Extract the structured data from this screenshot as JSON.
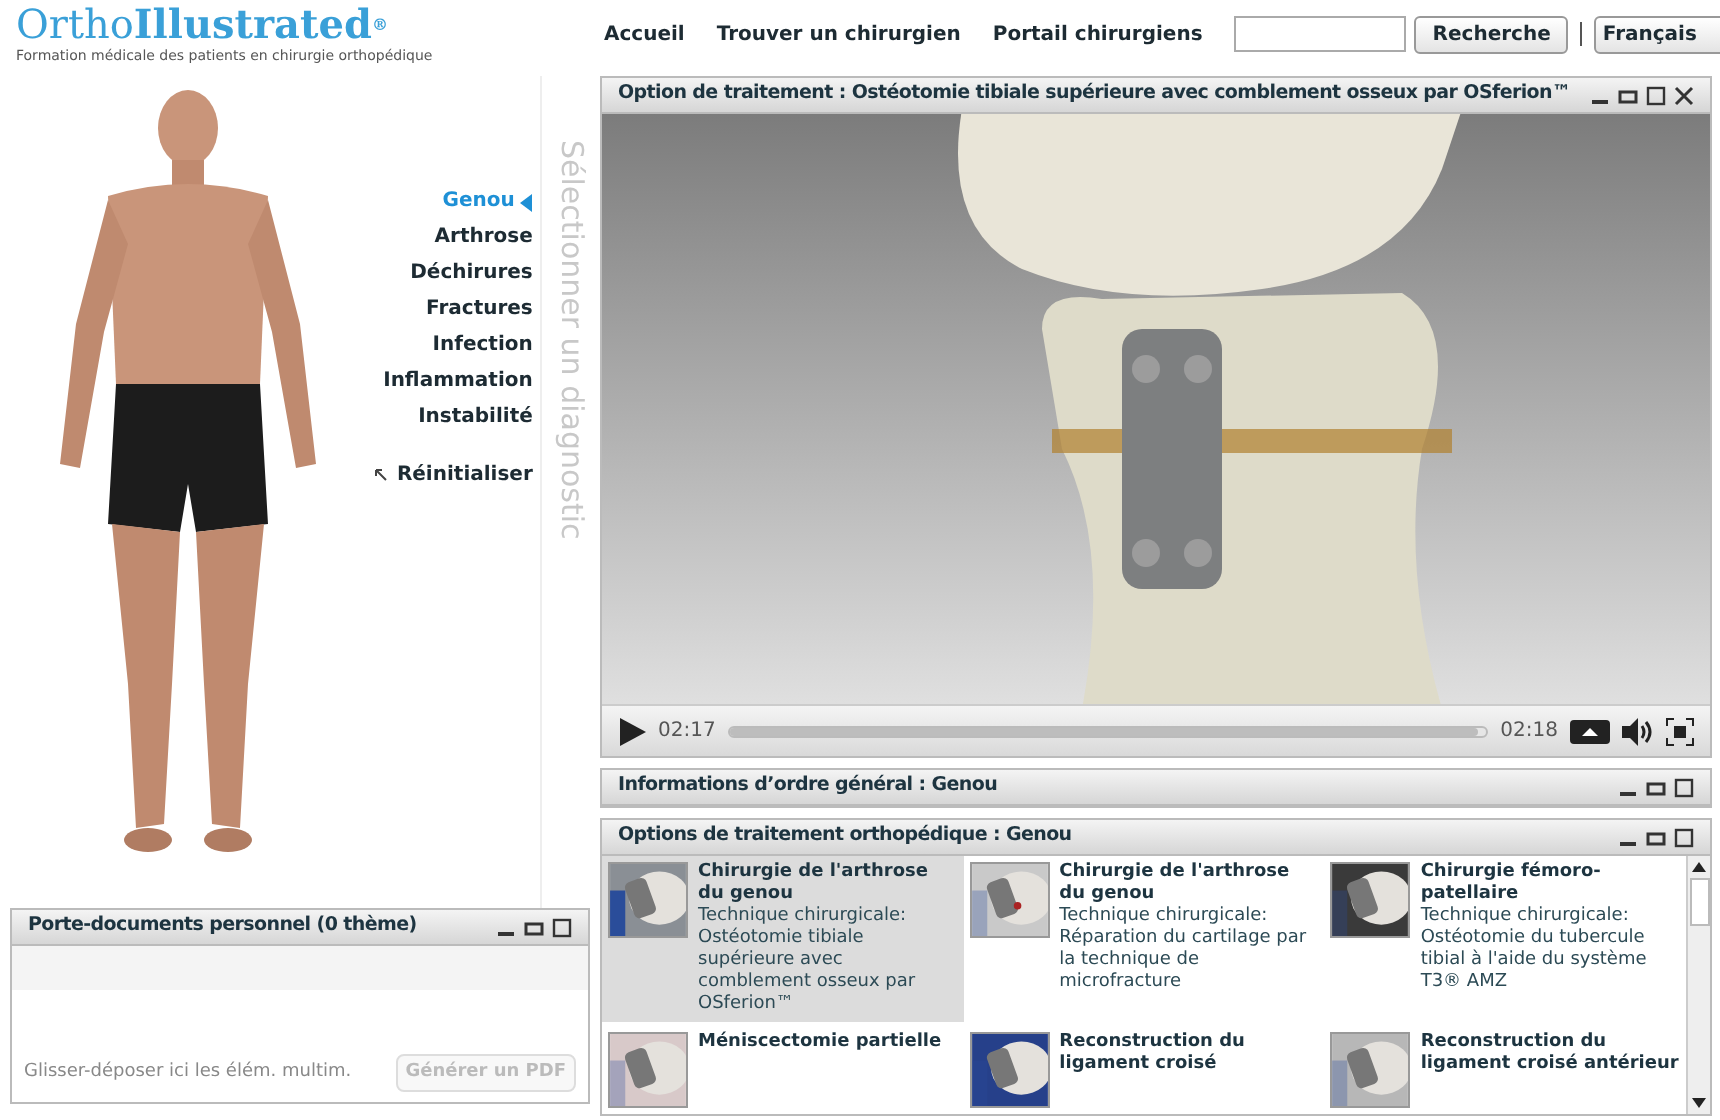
{
  "logo": {
    "part1": "Ortho",
    "part2": "Illustrated",
    "mark": "®",
    "tagline": "Formation médicale des patients en chirurgie orthopédique"
  },
  "nav": [
    {
      "label": "Accueil"
    },
    {
      "label": "Trouver un chirurgien"
    },
    {
      "label": "Portail chirurgiens"
    }
  ],
  "search": {
    "button": "Recherche"
  },
  "language": {
    "value": "Français"
  },
  "diagnosis_menu": {
    "items": [
      {
        "label": "Genou",
        "selected": true
      },
      {
        "label": "Arthrose",
        "selected": false
      },
      {
        "label": "Déchirures",
        "selected": false
      },
      {
        "label": "Fractures",
        "selected": false
      },
      {
        "label": "Infection",
        "selected": false
      },
      {
        "label": "Inflammation",
        "selected": false
      },
      {
        "label": "Instabilité",
        "selected": false
      }
    ],
    "reset": "Réinitialiser",
    "vertical_label": "Sélectionner un diagnostic"
  },
  "portfolio": {
    "title": "Porte-documents personnel (0 thème)",
    "hint": "Glisser-déposer ici les élém. multim.",
    "button": "Générer un PDF",
    "button_disabled": true
  },
  "video_panel": {
    "title": "Option de traitement : Ostéotomie tibiale supérieure avec comblement osseux par OSferion™",
    "elapsed": "02:17",
    "duration": "02:18",
    "level": 0.99
  },
  "info_panel": {
    "title": "Informations d’ordre général : Genou"
  },
  "options_panel": {
    "title": "Options de traitement orthopédique : Genou",
    "items": [
      {
        "title": "Chirurgie de l'arthrose du genou",
        "description": "Technique chirurgicale: Ostéotomie tibiale supérieure avec comblement osseux par OSferion™",
        "selected": true
      },
      {
        "title": "Chirurgie de l'arthrose du genou",
        "description": "Technique chirurgicale: Réparation du cartilage par la technique de microfracture",
        "selected": false
      },
      {
        "title": "Chirurgie fémoro-patellaire",
        "description": "Technique chirurgicale: Ostéotomie du tubercule tibial à l'aide du système T3® AMZ",
        "selected": false
      },
      {
        "title": "Méniscectomie partielle",
        "selected": false
      },
      {
        "title": "Reconstruction du ligament croisé",
        "selected": false
      },
      {
        "title": "Reconstruction du ligament croisé antérieur",
        "selected": false
      }
    ]
  }
}
